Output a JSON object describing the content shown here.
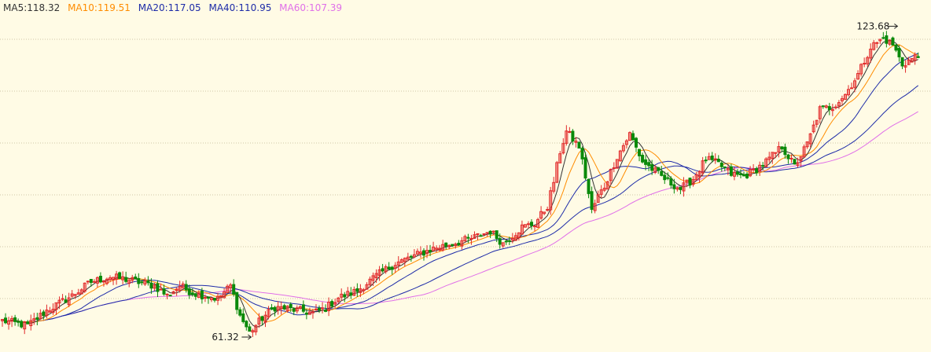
{
  "legend": {
    "ma5": "MA5:118.32",
    "ma10": "MA10:119.51",
    "ma20": "MA20:117.05",
    "ma40": "MA40:110.95",
    "ma60": "MA60:107.39"
  },
  "colors": {
    "background": "#fffbe5",
    "grid": "#cfc6a6",
    "up": "#e22a2a",
    "down": "#0a8a0a",
    "ma5": "#333333",
    "ma10": "#ff8c00",
    "ma20": "#1e2ca8",
    "ma40": "#1e2ca8",
    "ma60": "#e070e8"
  },
  "annotations": {
    "high": "123.68",
    "low": "61.32"
  },
  "chart_data": {
    "type": "candlestick",
    "title": "",
    "xlabel": "",
    "ylabel": "",
    "ylim": [
      60,
      127
    ],
    "grid": true,
    "legend_position": "top-left",
    "high_value": 123.68,
    "low_value": 61.32,
    "series": [
      {
        "name": "MA5",
        "last": 118.32
      },
      {
        "name": "MA10",
        "last": 119.51
      },
      {
        "name": "MA20",
        "last": 117.05
      },
      {
        "name": "MA40",
        "last": 110.95
      },
      {
        "name": "MA60",
        "last": 107.39
      }
    ],
    "close_anchors": [
      [
        0,
        66.0
      ],
      [
        8,
        65.0
      ],
      [
        14,
        68.0
      ],
      [
        22,
        71.0
      ],
      [
        28,
        73.8
      ],
      [
        34,
        74.8
      ],
      [
        40,
        74.2
      ],
      [
        48,
        73.0
      ],
      [
        52,
        71.0
      ],
      [
        56,
        73.0
      ],
      [
        60,
        71.6
      ],
      [
        64,
        71.0
      ],
      [
        68,
        70.4
      ],
      [
        72,
        73.0
      ],
      [
        75,
        67.0
      ],
      [
        78,
        63.6
      ],
      [
        82,
        66.5
      ],
      [
        86,
        68.7
      ],
      [
        90,
        68.4
      ],
      [
        94,
        68.0
      ],
      [
        98,
        67.5
      ],
      [
        102,
        68.5
      ],
      [
        106,
        70.6
      ],
      [
        112,
        72.0
      ],
      [
        118,
        75.0
      ],
      [
        124,
        77.5
      ],
      [
        130,
        79.0
      ],
      [
        136,
        80.5
      ],
      [
        142,
        81.5
      ],
      [
        148,
        82.5
      ],
      [
        154,
        84.0
      ],
      [
        158,
        81.5
      ],
      [
        164,
        84.8
      ],
      [
        168,
        85.5
      ],
      [
        172,
        89.0
      ],
      [
        174,
        94.0
      ],
      [
        176,
        100.0
      ],
      [
        178,
        104.0
      ],
      [
        182,
        101.0
      ],
      [
        184,
        95.0
      ],
      [
        186,
        88.0
      ],
      [
        188,
        91.0
      ],
      [
        190,
        93.0
      ],
      [
        194,
        99.0
      ],
      [
        198,
        103.5
      ],
      [
        202,
        98.0
      ],
      [
        206,
        96.0
      ],
      [
        210,
        94.0
      ],
      [
        214,
        92.5
      ],
      [
        218,
        94.5
      ],
      [
        222,
        98.5
      ],
      [
        226,
        97.5
      ],
      [
        230,
        95.5
      ],
      [
        234,
        95.0
      ],
      [
        238,
        96.5
      ],
      [
        242,
        98.5
      ],
      [
        246,
        101.0
      ],
      [
        250,
        97.0
      ],
      [
        254,
        101.5
      ],
      [
        258,
        108.5
      ],
      [
        262,
        109.0
      ],
      [
        266,
        111.5
      ],
      [
        270,
        115.5
      ],
      [
        274,
        121.0
      ],
      [
        278,
        122.8
      ],
      [
        281,
        121.5
      ],
      [
        284,
        117.5
      ],
      [
        288,
        119.0
      ]
    ]
  }
}
